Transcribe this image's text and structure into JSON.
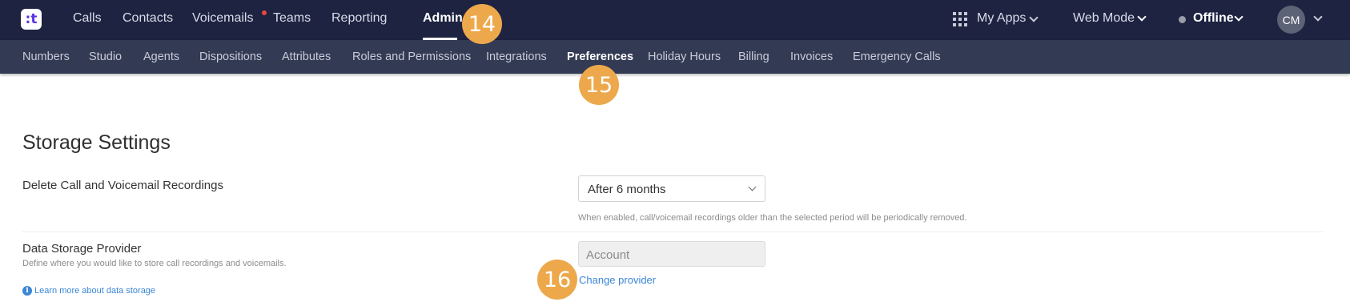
{
  "topnav": {
    "items": [
      {
        "label": "Calls"
      },
      {
        "label": "Contacts"
      },
      {
        "label": "Voicemails"
      },
      {
        "label": "Teams"
      },
      {
        "label": "Reporting"
      },
      {
        "label": "Admin",
        "active": true
      }
    ],
    "my_apps": "My Apps",
    "web_mode": "Web Mode",
    "status": "Offline",
    "avatar_initials": "CM"
  },
  "subnav": {
    "items": [
      {
        "label": "Numbers"
      },
      {
        "label": "Studio"
      },
      {
        "label": "Agents"
      },
      {
        "label": "Dispositions"
      },
      {
        "label": "Attributes"
      },
      {
        "label": "Roles and Permissions"
      },
      {
        "label": "Integrations"
      },
      {
        "label": "Preferences",
        "active": true
      },
      {
        "label": "Holiday Hours"
      },
      {
        "label": "Billing"
      },
      {
        "label": "Invoices"
      },
      {
        "label": "Emergency Calls"
      }
    ]
  },
  "badges": {
    "admin": "14",
    "preferences": "15",
    "provider": "16"
  },
  "storage": {
    "title": "Storage Settings",
    "delete_label": "Delete Call and Voicemail Recordings",
    "delete_value": "After 6 months",
    "delete_help": "When enabled, call/voicemail recordings older than the selected period will be periodically removed.",
    "provider_label": "Data Storage Provider",
    "provider_desc": "Define where you would like to store call recordings and voicemails.",
    "provider_value": "Account",
    "change_provider": "Change provider",
    "learn_more": "Learn more about data storage"
  },
  "colors": {
    "topbar": "#1d2340",
    "subbar": "#333a54",
    "badge": "#eda84c",
    "link": "#3b86d6"
  }
}
